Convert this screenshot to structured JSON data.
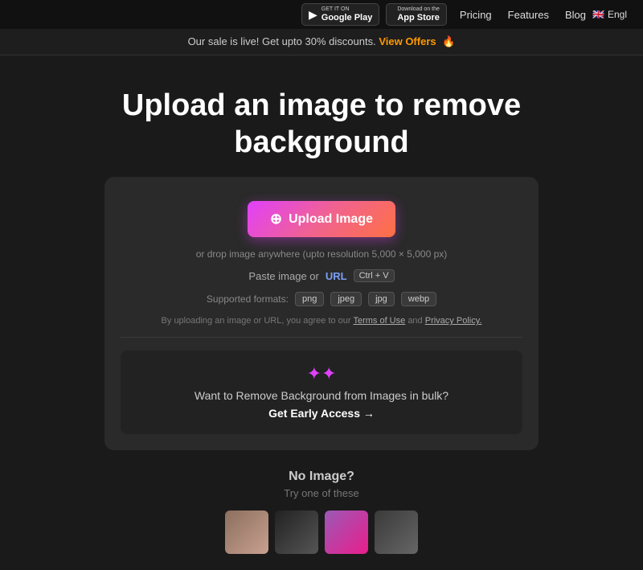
{
  "nav": {
    "google_play_get": "GET IT ON",
    "google_play_name": "Google Play",
    "app_store_get": "Download on the",
    "app_store_name": "App Store",
    "links": [
      "Pricing",
      "Features",
      "Blog"
    ],
    "language": "Engl",
    "flag": "🇬🇧"
  },
  "banner": {
    "text": "Our sale is live! Get upto 30% discounts.",
    "cta": "View Offers",
    "emoji": "🔥"
  },
  "hero": {
    "title_line1": "Upload an image to remove",
    "title_line2": "background"
  },
  "upload_card": {
    "button_label": "Upload Image",
    "drop_text": "or drop image anywhere (upto resolution 5,000 × 5,000 px)",
    "paste_label": "Paste image or",
    "url_label": "URL",
    "shortcut": "Ctrl + V",
    "formats_label": "Supported formats:",
    "formats": [
      "png",
      "jpeg",
      "jpg",
      "webp"
    ],
    "terms_prefix": "By uploading an image or URL, you agree to our",
    "terms_link": "Terms of Use",
    "terms_mid": "and",
    "privacy_link": "Privacy Policy.",
    "bulk_title": "Want to Remove Background from Images in bulk?",
    "bulk_cta": "Get Early Access →"
  },
  "no_image": {
    "title": "No Image?",
    "subtitle": "Try one of these"
  },
  "colors": {
    "accent_purple": "#e040fb",
    "accent_blue": "#7b9ff7",
    "bg_dark": "#1a1a1a",
    "card_bg": "#2a2a2a"
  }
}
